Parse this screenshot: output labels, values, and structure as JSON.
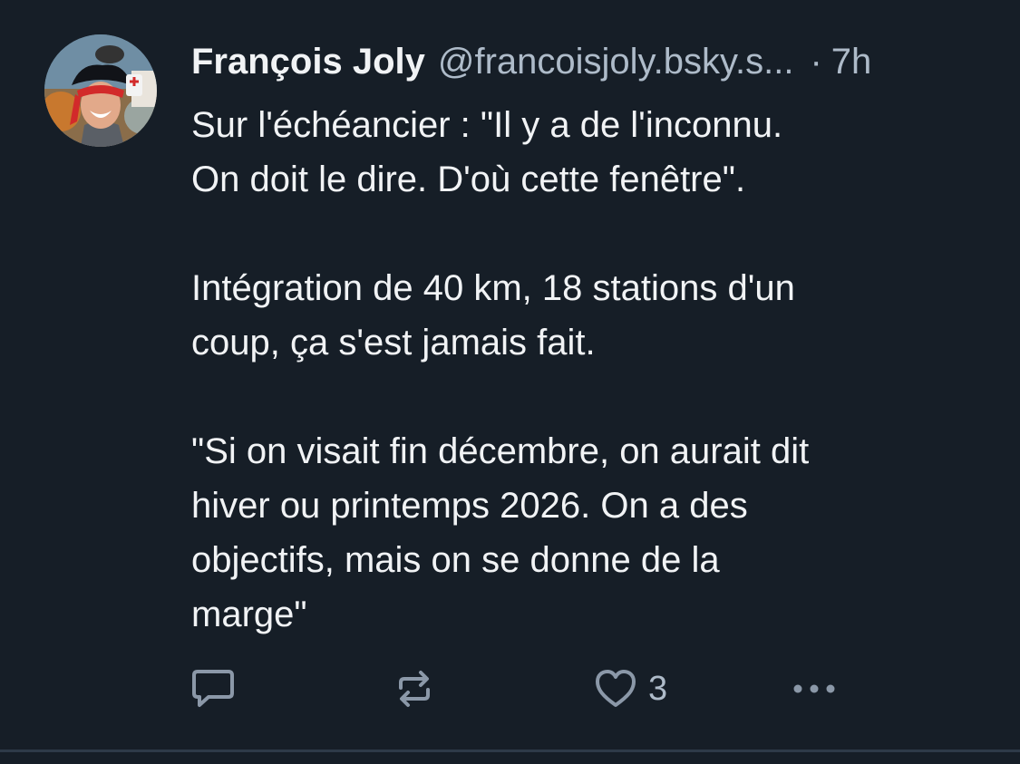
{
  "post": {
    "author": {
      "display_name": "François Joly",
      "handle": "@francoisjoly.bsky.s...",
      "avatar_icon": "avatar-photo-pirate-hat"
    },
    "separator": "·",
    "time": "7h",
    "paragraphs": [
      [
        "Sur l'échéancier : \"Il y a de l'inconnu.",
        "On doit le dire. D'où cette fenêtre\"."
      ],
      [
        "Intégration de 40 km, 18 stations d'un",
        "coup, ça s'est jamais fait."
      ],
      [
        "\"Si on visait fin décembre, on aurait dit",
        "hiver ou printemps 2026. On a des",
        "objectifs, mais on se donne de la",
        "marge\""
      ]
    ],
    "actions": {
      "reply_icon": "reply-icon",
      "repost_icon": "repost-icon",
      "like_icon": "heart-icon",
      "like_count": "3",
      "more_icon": "more-icon"
    }
  },
  "colors": {
    "background": "#161e27",
    "text": "#f1f3f5",
    "muted": "#aebbc9",
    "icon": "#8b98a8",
    "divider": "#2e3a48"
  }
}
